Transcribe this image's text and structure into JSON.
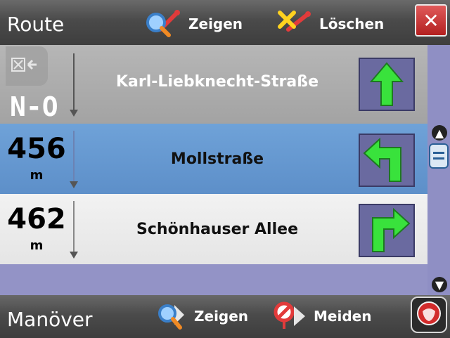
{
  "header": {
    "title": "Route",
    "show_label": "Zeigen",
    "delete_label": "Löschen"
  },
  "orientation": {
    "label": "N-O"
  },
  "maneuvers": [
    {
      "street": "Karl-Liebknecht-Straße",
      "distance": "",
      "unit": "",
      "turn": "straight"
    },
    {
      "street": "Mollstraße",
      "distance": "456",
      "unit": "m",
      "turn": "left"
    },
    {
      "street": "Schönhauser Allee",
      "distance": "462",
      "unit": "m",
      "turn": "right"
    }
  ],
  "footer": {
    "title": "Manöver",
    "show_label": "Zeigen",
    "avoid_label": "Meiden"
  },
  "colors": {
    "toolbar_bg": "#4a4a4a",
    "selected_row": "#6fa2d8",
    "turn_arrow": "#39e23c",
    "close_red": "#c43030"
  }
}
